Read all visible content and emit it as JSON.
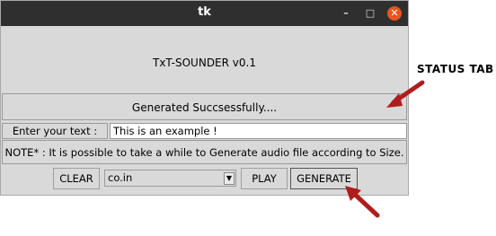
{
  "window": {
    "title": "tk",
    "controls": {
      "minimize": "–",
      "maximize": "□",
      "close": "✕"
    }
  },
  "app": {
    "title": "TxT-SOUNDER v0.1",
    "status": "Generated Succsessfully....",
    "input_label": "Enter your text :",
    "input_value": "This is an example !",
    "note": "NOTE* : It is possible to take a while to Generate audio file according to Size.",
    "buttons": {
      "clear": "CLEAR",
      "play": "PLAY",
      "generate": "GENERATE"
    },
    "domain_select": {
      "value": "co.in"
    }
  },
  "annotations": {
    "status_tab_label": "STATUS TAB",
    "arrow_color": "#b01c1c"
  },
  "colors": {
    "titlebar": "#2f2f2f",
    "window_bg": "#d9d9d9",
    "close_button": "#e95420"
  }
}
